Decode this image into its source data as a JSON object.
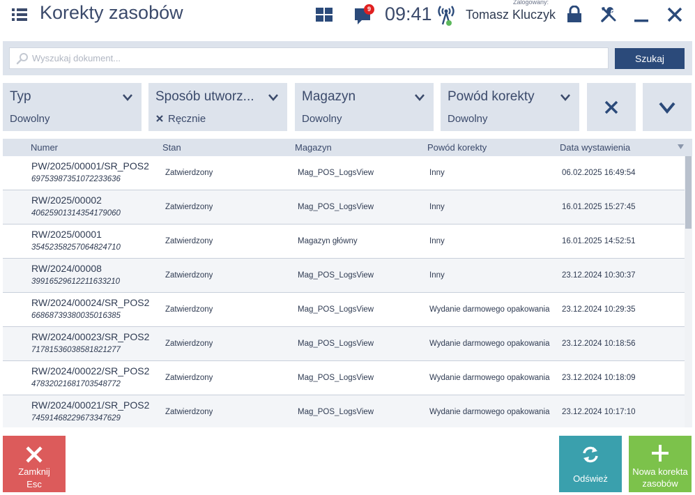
{
  "header": {
    "title": "Korekty zasobów",
    "notifications_count": "9",
    "time": "09:41",
    "logged_label": "Zalogowany:",
    "user_name": "Tomasz Kluczyk"
  },
  "search": {
    "placeholder": "Wyszukaj dokument...",
    "button_label": "Szukaj"
  },
  "filters": [
    {
      "title": "Typ",
      "value": "Dowolny"
    },
    {
      "title": "Sposób utworz...",
      "value": "Ręcznie"
    },
    {
      "title": "Magazyn",
      "value": "Dowolny"
    },
    {
      "title": "Powód korekty",
      "value": "Dowolny"
    }
  ],
  "table": {
    "columns": [
      "Numer",
      "Stan",
      "Magazyn",
      "Powód korekty",
      "Data wystawienia"
    ],
    "rows": [
      {
        "numer": "PW/2025/00001/SR_POS2",
        "kod": "69753987351072233636",
        "stan": "Zatwierdzony",
        "magazyn": "Mag_POS_LogsView",
        "powod": "Inny",
        "data": "06.02.2025 16:49:54"
      },
      {
        "numer": "RW/2025/00002",
        "kod": "40625901314354179060",
        "stan": "Zatwierdzony",
        "magazyn": "Mag_POS_LogsView",
        "powod": "Inny",
        "data": "16.01.2025 15:27:45"
      },
      {
        "numer": "RW/2025/00001",
        "kod": "35452358257064824710",
        "stan": "Zatwierdzony",
        "magazyn": "Magazyn główny",
        "powod": "Inny",
        "data": "16.01.2025 14:52:51"
      },
      {
        "numer": "RW/2024/00008",
        "kod": "39916529612211633210",
        "stan": "Zatwierdzony",
        "magazyn": "Mag_POS_LogsView",
        "powod": "Inny",
        "data": "23.12.2024 10:30:37"
      },
      {
        "numer": "RW/2024/00024/SR_POS2",
        "kod": "66868739380035016385",
        "stan": "Zatwierdzony",
        "magazyn": "Mag_POS_LogsView",
        "powod": "Wydanie darmowego opakowania",
        "data": "23.12.2024 10:29:35"
      },
      {
        "numer": "RW/2024/00023/SR_POS2",
        "kod": "71781536038581821277",
        "stan": "Zatwierdzony",
        "magazyn": "Mag_POS_LogsView",
        "powod": "Wydanie darmowego opakowania",
        "data": "23.12.2024 10:18:56"
      },
      {
        "numer": "RW/2024/00022/SR_POS2",
        "kod": "47832021681703548772",
        "stan": "Zatwierdzony",
        "magazyn": "Mag_POS_LogsView",
        "powod": "Wydanie darmowego opakowania",
        "data": "23.12.2024 10:18:09"
      },
      {
        "numer": "RW/2024/00021/SR_POS2",
        "kod": "74591468229673347629",
        "stan": "Zatwierdzony",
        "magazyn": "Mag_POS_LogsView",
        "powod": "Wydanie darmowego opakowania",
        "data": "23.12.2024 10:17:10"
      }
    ]
  },
  "buttons": {
    "close_line1": "Zamknij",
    "close_line2": "Esc",
    "refresh": "Odśwież",
    "new_line1": "Nowa korekta",
    "new_line2": "zasobów"
  },
  "colors": {
    "accent": "#2b4a7a",
    "filter_bg": "#dde3ec",
    "close": "#dc5b5b",
    "refresh": "#3aa0ad",
    "new": "#7cc24b",
    "badge": "#e02020"
  },
  "icons": {
    "menu": "hamburger-icon",
    "tiles": "tiles-icon",
    "notifications": "chat-bubble-icon",
    "signal": "signal-tower-icon",
    "lock": "lock-icon",
    "tools": "tools-icon",
    "minimize": "minimize-icon",
    "close": "close-icon",
    "search": "search-icon",
    "refresh": "refresh-icon",
    "add": "plus-icon"
  }
}
